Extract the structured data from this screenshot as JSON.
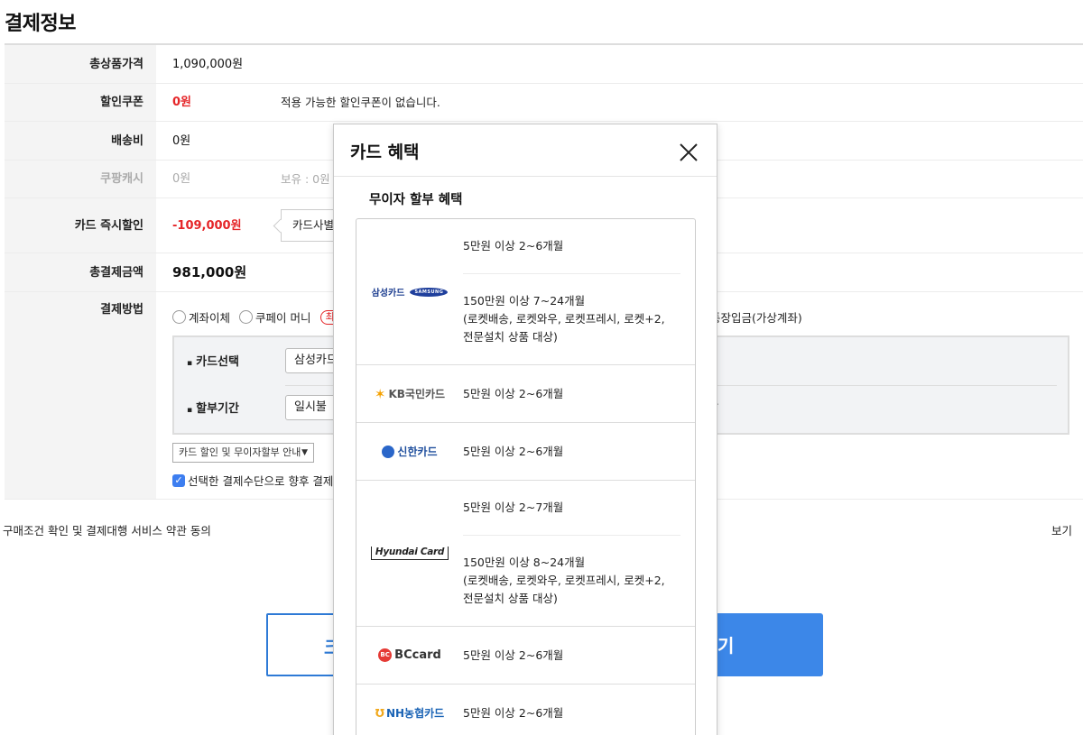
{
  "page_title": "결제정보",
  "rows": {
    "total_price": {
      "label": "총상품가격",
      "value": "1,090,000원"
    },
    "coupon": {
      "label": "할인쿠폰",
      "value": "0원",
      "note": "적용 가능한 할인쿠폰이 없습니다."
    },
    "shipping": {
      "label": "배송비",
      "value": "0원"
    },
    "cash": {
      "label": "쿠팡캐시",
      "value": "0원",
      "note": "보유 : 0원"
    },
    "card_discount": {
      "label": "카드 즉시할인",
      "value": "-109,000원",
      "box": "카드사별"
    },
    "total_payment": {
      "label": "총결제금액",
      "value": "981,000원"
    },
    "payment_method": {
      "label": "결제방법"
    }
  },
  "payment_options": {
    "transfer": "계좌이체",
    "coupay": "쿠페이 머니",
    "badge": "최",
    "virtual": "통장입금(가상계좌)"
  },
  "card_panel": {
    "card_label": "카드선택",
    "card_value": "삼성카드",
    "installment_label": "할부기간",
    "installment_value": "일시불",
    "dot": "."
  },
  "guide_select": "카드 할인 및 무이자할부 안내",
  "save_check": "선택한 결제수단으로 향후 결제",
  "terms": {
    "text": "구매조건 확인 및 결제대행 서비스 약관 동의",
    "view": "보기"
  },
  "buttons": {
    "left": "크",
    "right": "기"
  },
  "modal": {
    "title": "카드 혜택",
    "section": "무이자 할부 혜택",
    "cards": [
      {
        "logo": "samsung-card",
        "logo_text": "삼성카드",
        "logo_sub": "SAMSUNG",
        "terms": [
          "5만원 이상 2~6개월",
          "150만원 이상 7~24개월",
          "(로켓배송, 로켓와우, 로켓프레시, 로켓+2,",
          "전문설치 상품 대상)"
        ]
      },
      {
        "logo": "kb-card",
        "logo_text": "KB국민카드",
        "terms": [
          "5만원 이상 2~6개월"
        ]
      },
      {
        "logo": "shinhan-card",
        "logo_text": "신한카드",
        "terms": [
          "5만원 이상 2~6개월"
        ]
      },
      {
        "logo": "hyundai-card",
        "logo_text": "Hyundai Card",
        "terms": [
          "5만원 이상 2~7개월",
          "150만원 이상 8~24개월",
          "(로켓배송, 로켓와우, 로켓프레시, 로켓+2,",
          "전문설치 상품 대상)"
        ]
      },
      {
        "logo": "bc-card",
        "logo_text": "BCcard",
        "terms": [
          "5만원 이상 2~6개월"
        ]
      },
      {
        "logo": "nh-card",
        "logo_text": "NH농협카드",
        "terms": [
          "5만원 이상 2~6개월"
        ]
      }
    ]
  },
  "colors": {
    "red": "#e52528",
    "blue": "#3c87e8",
    "checkbox": "#3d7ef0"
  }
}
